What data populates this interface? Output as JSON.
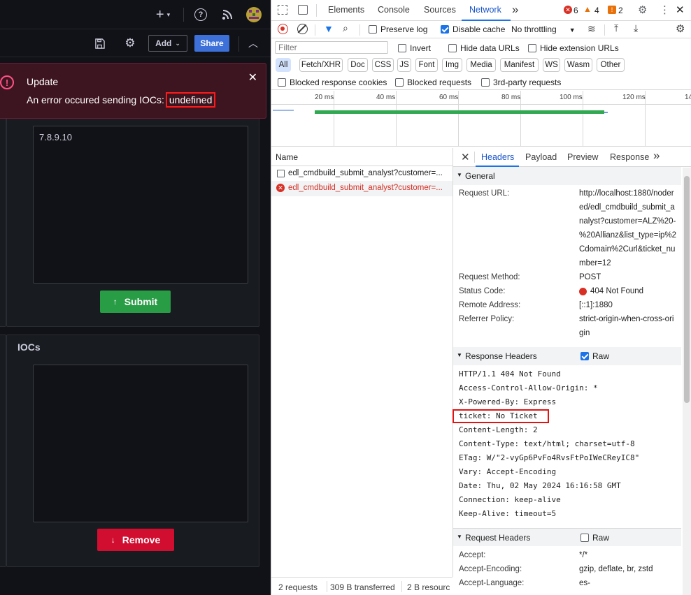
{
  "grafana": {
    "topbar": {
      "add_icon": "plus-icon",
      "help_icon": "help-icon",
      "rss_icon": "rss-icon",
      "avatar_icon": "avatar-icon"
    },
    "toolbar": {
      "save_icon": "save-icon",
      "settings_icon": "gear-icon",
      "add_label": "Add",
      "share_label": "Share",
      "collapse_icon": "chevron-up-icon"
    },
    "toast": {
      "title": "Update",
      "message": "An error occured sending IOCs:",
      "highlight": "undefined"
    },
    "input_panel": {
      "textarea_value": "7.8.9.10",
      "submit_label": "Submit"
    },
    "iocs_panel": {
      "title": "IOCs",
      "remove_label": "Remove"
    },
    "colors": {
      "bg": "#111217",
      "panel": "#181b1f",
      "submit": "#299c46",
      "remove": "#d10e2f",
      "share": "#3d71d9",
      "toast": "#3d1520"
    }
  },
  "devtools": {
    "tabs": [
      "Elements",
      "Console",
      "Sources",
      "Network"
    ],
    "active_tab": "Network",
    "more_tabs": "»",
    "errors": "6",
    "warnings": "4",
    "issues": "2",
    "toolbar": {
      "preserve_log": "Preserve log",
      "disable_cache": "Disable cache",
      "throttling": "No throttling"
    },
    "filter": {
      "placeholder": "Filter",
      "invert": "Invert",
      "hide_data_urls": "Hide data URLs",
      "hide_extension_urls": "Hide extension URLs"
    },
    "type_filters": [
      "All",
      "Fetch/XHR",
      "Doc",
      "CSS",
      "JS",
      "Font",
      "Img",
      "Media",
      "Manifest",
      "WS",
      "Wasm",
      "Other"
    ],
    "blocked": {
      "response_cookies": "Blocked response cookies",
      "requests": "Blocked requests",
      "third_party": "3rd-party requests"
    },
    "timeline_ticks": [
      "20 ms",
      "40 ms",
      "60 ms",
      "80 ms",
      "100 ms",
      "120 ms",
      "14"
    ],
    "name_header": "Name",
    "requests": [
      {
        "name": "edl_cmdbuild_submit_analyst?customer=...",
        "status": "ok"
      },
      {
        "name": "edl_cmdbuild_submit_analyst?customer=...",
        "status": "error"
      }
    ],
    "footer": {
      "requests": "2 requests",
      "transferred": "309 B transferred",
      "resources": "2 B resourc"
    },
    "detail_tabs": [
      "Headers",
      "Payload",
      "Preview",
      "Response"
    ],
    "general": {
      "title": "General",
      "request_url_label": "Request URL:",
      "request_url_lines": [
        "http://localhost:1880/noder",
        "ed/edl_cmdbuild_submit_a",
        "nalyst?customer=ALZ%20-",
        "%20Allianz&list_type=ip%2",
        "Cdomain%2Curl&ticket_nu",
        "mber=12"
      ],
      "method_label": "Request Method:",
      "method": "POST",
      "status_label": "Status Code:",
      "status": "404 Not Found",
      "remote_label": "Remote Address:",
      "remote": "[::1]:1880",
      "referrer_label": "Referrer Policy:",
      "referrer_lines": [
        "strict-origin-when-cross-ori",
        "gin"
      ]
    },
    "response_headers": {
      "title": "Response Headers",
      "raw": "Raw",
      "lines": [
        "HTTP/1.1 404 Not Found",
        "Access-Control-Allow-Origin: *",
        "X-Powered-By: Express",
        "ticket: No Ticket",
        "Content-Length: 2",
        "Content-Type: text/html; charset=utf-8",
        "ETag: W/\"2-vyGp6PvFo4RvsFtPoIWeCReyIC8\"",
        "Vary: Accept-Encoding",
        "Date: Thu, 02 May 2024 16:16:58 GMT",
        "Connection: keep-alive",
        "Keep-Alive: timeout=5"
      ]
    },
    "request_headers": {
      "title": "Request Headers",
      "raw": "Raw",
      "accept_label": "Accept:",
      "accept": "*/*",
      "encoding_label": "Accept-Encoding:",
      "encoding": "gzip, deflate, br, zstd",
      "language_label": "Accept-Language:",
      "language": "es-"
    }
  }
}
